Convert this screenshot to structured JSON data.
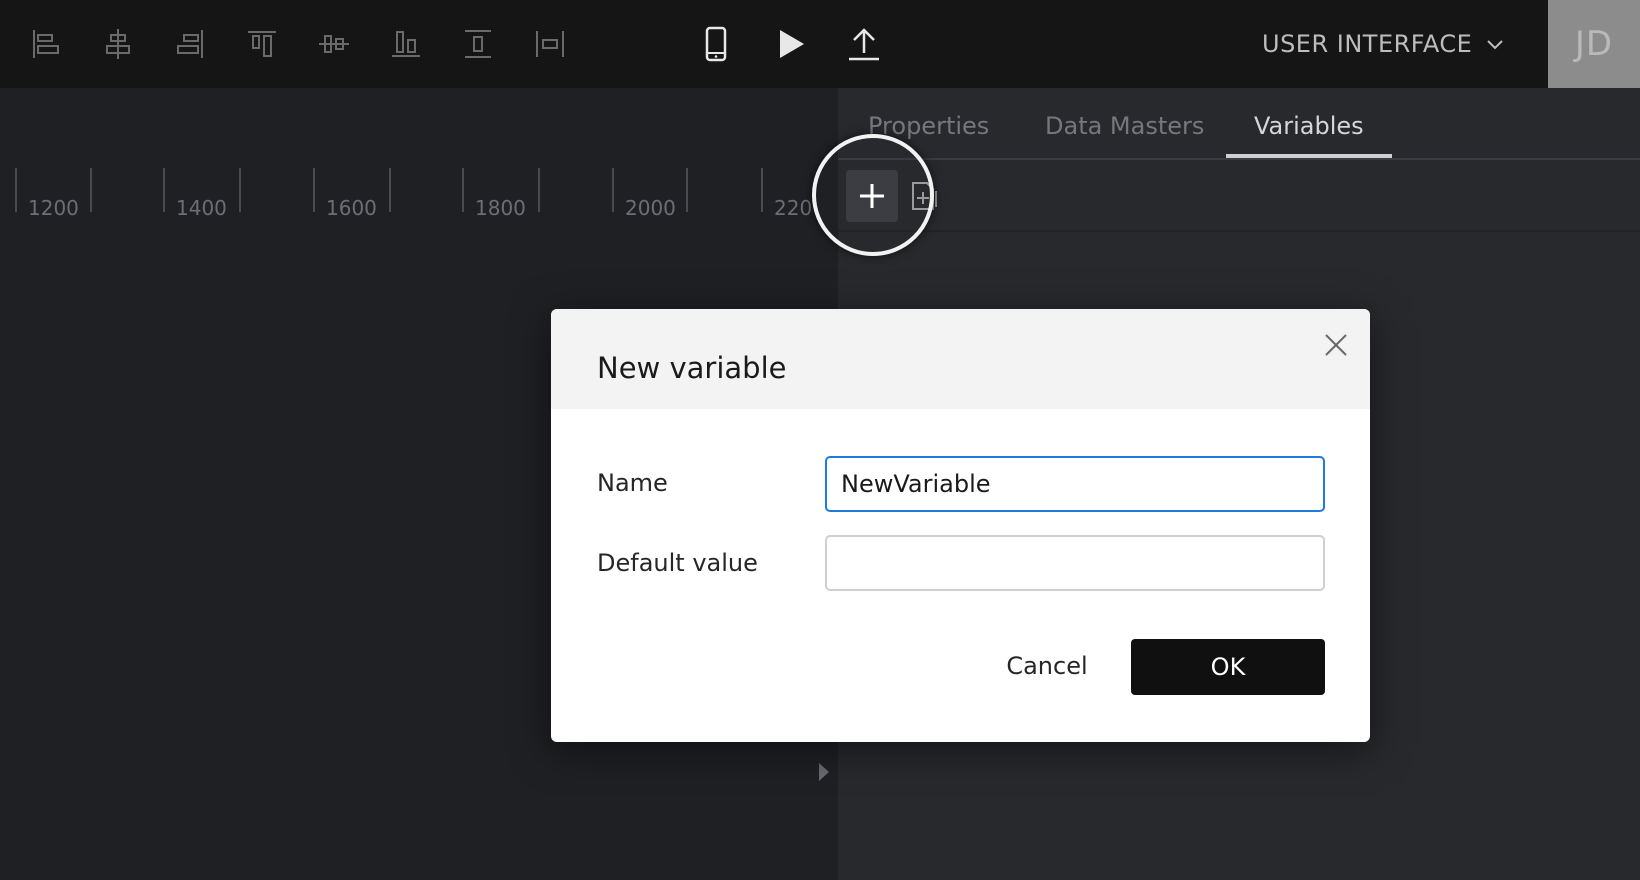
{
  "toolbar": {
    "align_tools": [
      {
        "icon": "align-left-icon"
      },
      {
        "icon": "align-center-horizontal-icon"
      },
      {
        "icon": "align-right-icon"
      },
      {
        "icon": "align-top-icon"
      },
      {
        "icon": "align-middle-vertical-icon"
      },
      {
        "icon": "align-bottom-icon"
      },
      {
        "icon": "distribute-vertical-icon"
      },
      {
        "icon": "distribute-horizontal-icon"
      }
    ],
    "device_icon": "mobile-device-icon",
    "play_icon": "play-icon",
    "upload_icon": "upload-icon",
    "ui_menu_label": "USER INTERFACE",
    "avatar_initials": "JD"
  },
  "ruler": {
    "labels": [
      "1200",
      "1400",
      "1600",
      "1800",
      "2000",
      "220"
    ]
  },
  "panel": {
    "tabs": [
      {
        "label": "Properties",
        "active": false
      },
      {
        "label": "Data Masters",
        "active": false
      },
      {
        "label": "Variables",
        "active": true
      }
    ]
  },
  "dialog": {
    "title": "New variable",
    "name_label": "Name",
    "name_value": "NewVariable",
    "default_label": "Default value",
    "default_value": "",
    "cancel_label": "Cancel",
    "ok_label": "OK"
  },
  "colors": {
    "topbar_bg": "#151515",
    "canvas_bg": "#1f2024",
    "panel_bg": "#28292d",
    "input_focus": "#1f7ae0",
    "ok_bg": "#101010"
  }
}
